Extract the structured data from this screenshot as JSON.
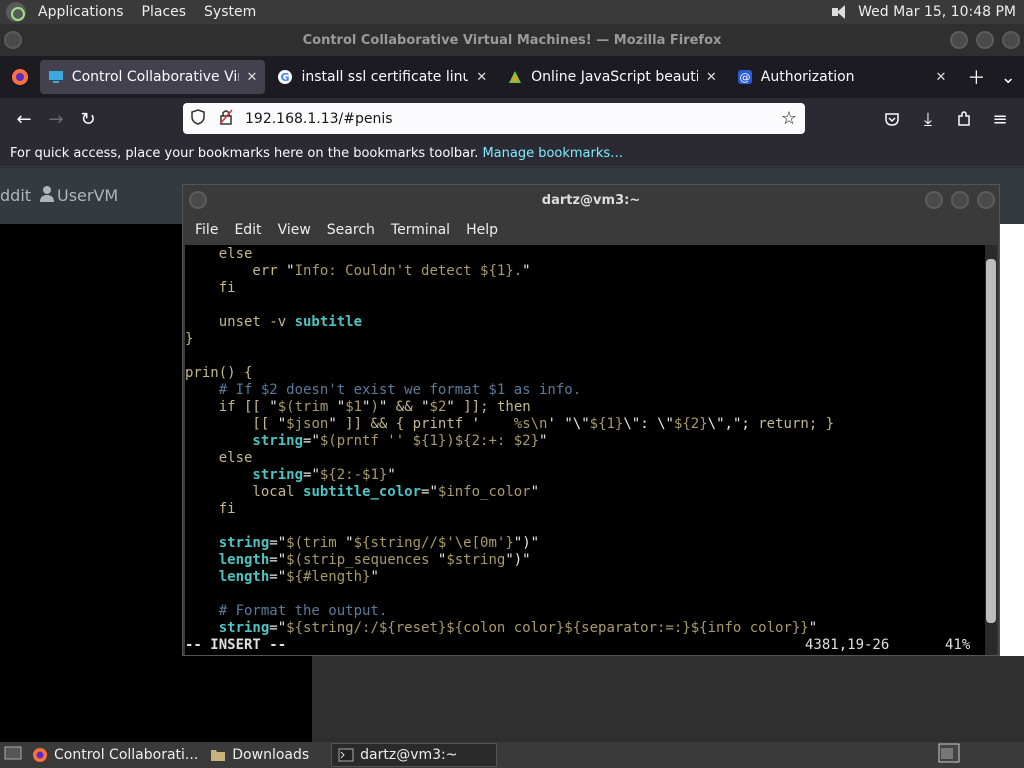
{
  "top_panel": {
    "menus": [
      "Applications",
      "Places",
      "System"
    ],
    "clock": "Wed Mar 15, 10:48 PM"
  },
  "firefox": {
    "window_title": "Control Collaborative Virtual Machines! — Mozilla Firefox",
    "tabs": [
      {
        "title": "Control Collaborative Virtua",
        "active": true
      },
      {
        "title": "install ssl certificate linux - G",
        "active": false
      },
      {
        "title": "Online JavaScript beautifier",
        "active": false
      },
      {
        "title": "Authorization",
        "active": false
      }
    ],
    "url": "192.168.1.13/#penis",
    "bookmarks_msg": "For quick access, place your bookmarks here on the bookmarks toolbar.",
    "manage_bookmarks": "Manage bookmarks…"
  },
  "page": {
    "nav_partial": "ddit",
    "user_label": "UserVM"
  },
  "terminal": {
    "title": "dartz@vm3:~",
    "menu": [
      "File",
      "Edit",
      "View",
      "Search",
      "Terminal",
      "Help"
    ],
    "mode": "-- INSERT --",
    "position": "4381,19-26",
    "percent": "41%"
  },
  "taskbar": {
    "items": [
      "Control Collaborati...",
      "Downloads",
      "dartz@vm3:~"
    ]
  },
  "colors": {
    "accent_link": "#80ebff",
    "term_var": "#4fc3c3",
    "term_comment": "#5b7b9b"
  }
}
